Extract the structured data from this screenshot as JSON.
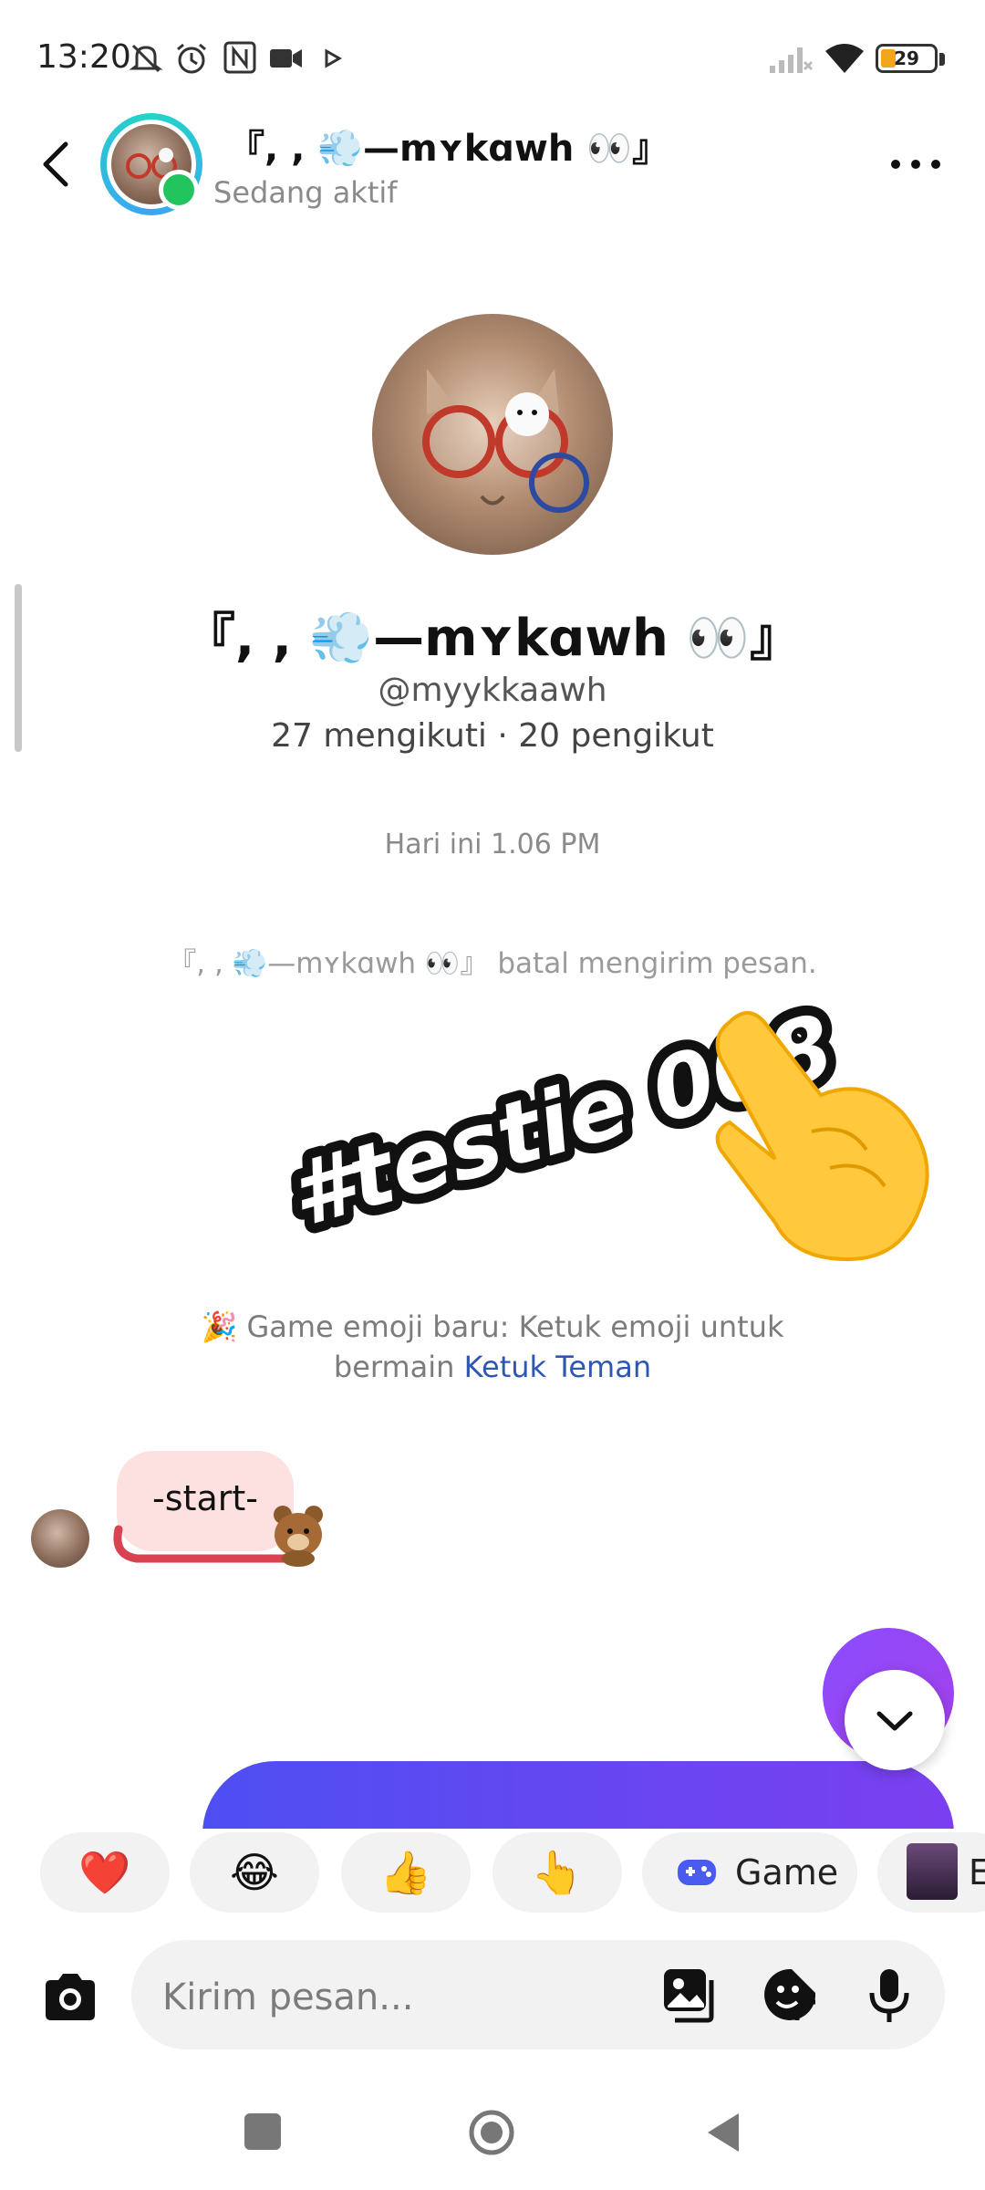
{
  "status_bar": {
    "time": "13:20",
    "battery": "29",
    "icons": [
      "bell-off-icon",
      "alarm-icon",
      "nfc-icon",
      "video-icon",
      "play-icon",
      "signal-icon",
      "wifi-icon",
      "battery-icon"
    ]
  },
  "header": {
    "name": "『, , 💨—mʏkɑwh 👀』",
    "status": "Sedang aktif"
  },
  "profile": {
    "name": "『, , 💨—mʏkɑwh 👀』",
    "handle": "@myykkaawh",
    "stats": "27 mengikuti · 20 pengikut"
  },
  "chat": {
    "timestamp": "Hari ini 1.06 PM",
    "unsent_notice": "『, , 💨—mʏkɑwh 👀』  batal mengirim pesan.",
    "sticker_text": "#testie 008",
    "game_notice_prefix": "🎉 Game emoji baru: Ketuk emoji untuk bermain ",
    "game_notice_link": "Ketuk Teman",
    "message": "-start-"
  },
  "quick_reactions": {
    "heart": "❤️",
    "laugh": "😂",
    "thumbs_up": "👍",
    "point": "👆",
    "game_label": "Game",
    "effect_label": "E"
  },
  "composer": {
    "placeholder": "Kirim pesan..."
  },
  "colors": {
    "accent_purple": "#8b4dff",
    "link_blue": "#2e57b3",
    "online_green": "#21c45d",
    "bubble_pink": "#fde0e0"
  }
}
